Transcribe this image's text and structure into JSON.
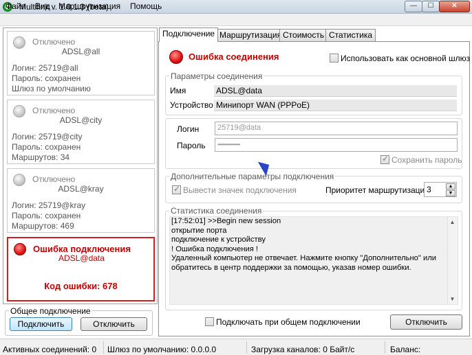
{
  "window": {
    "title": "Multilink v. 1.0.1.3 (beta)",
    "app_icon": "✆",
    "min": "—",
    "max": "☐",
    "close": "✕"
  },
  "menu": [
    "Файл",
    "Вид",
    "Маршрутизация",
    "Помощь"
  ],
  "connections": [
    {
      "status": "Отключено",
      "name": "ADSL@all",
      "lines": [
        "Логин: 25719@all",
        "Пароль: сохранен",
        "Шлюз по умолчанию"
      ]
    },
    {
      "status": "Отключено",
      "name": "ADSL@city",
      "lines": [
        "Логин: 25719@city",
        "Пароль: сохранен",
        "Маршрутов: 34"
      ]
    },
    {
      "status": "Отключено",
      "name": "ADSL@kray",
      "lines": [
        "Логин: 25719@kray",
        "Пароль: сохранен",
        "Маршрутов: 469"
      ]
    },
    {
      "status": "Ошибка подключения",
      "name": "ADSL@data",
      "error": "Код ошибки: 678"
    }
  ],
  "shared": {
    "title": "Общее подключение",
    "connect": "Подключить",
    "disconnect": "Отключить"
  },
  "tabs": [
    "Подключение",
    "Маршрутизация",
    "Стоимость",
    "Статистика"
  ],
  "main": {
    "error_title": "Ошибка соединения",
    "use_main_gateway": "Использовать как основной шлюз",
    "params_title": "Параметры соединения",
    "name_label": "Имя",
    "name_value": "ADSL@data",
    "device_label": "Устройство",
    "device_value": "Минипорт WAN (PPPoE)",
    "login_label": "Логин",
    "login_value": "25719@data",
    "password_label": "Пароль",
    "password_value": "••••••••••••••••••",
    "save_password": "Сохранить пароль",
    "extra_title": "Дополнительные параметры подключения",
    "show_icon": "Вывести значек подключения",
    "priority_label": "Приоритет маршрутизации",
    "priority_value": "3",
    "stats_title": "Статистика соединения",
    "log": [
      "[17:52:01] >>Begin new session",
      "открытие порта",
      "подключение к устройству",
      "! Ошибка подключения !",
      "Удаленный компьютер не отвечает. Нажмите кнопку \"Дополнительно\" или",
      "обратитесь в центр поддержки за помощью, указав номер ошибки."
    ],
    "connect_on_shared": "Подключать при общем подключении",
    "disconnect": "Отключить"
  },
  "status": {
    "active": "Активных соединений: 0",
    "gateway": "Шлюз по умолчанию: 0.0.0.0",
    "load": "Загрузка каналов: 0 Байт/с",
    "balance": "Баланс: (недоступно)"
  }
}
